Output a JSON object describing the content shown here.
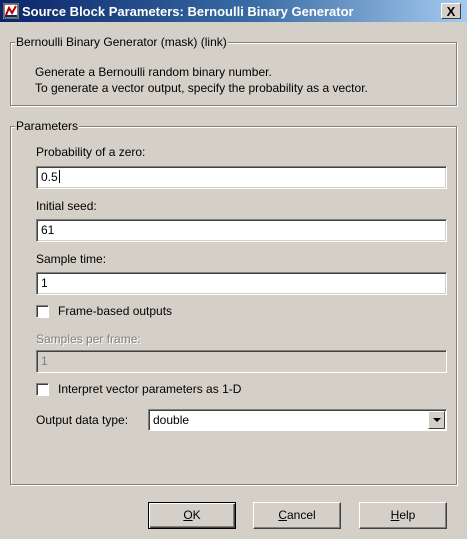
{
  "window": {
    "title": "Source Block Parameters: Bernoulli Binary Generator",
    "close_label": "X"
  },
  "description_group": {
    "legend": "Bernoulli Binary Generator (mask) (link)",
    "line1": "Generate a Bernoulli random binary number.",
    "line2": "To generate a vector output, specify the probability as a vector."
  },
  "parameters_group": {
    "legend": "Parameters",
    "probability_label": "Probability of a zero:",
    "probability_value": "0.5",
    "seed_label": "Initial seed:",
    "seed_value": "61",
    "sample_time_label": "Sample time:",
    "sample_time_value": "1",
    "frame_based_label": "Frame-based outputs",
    "frame_based_checked": false,
    "samples_per_frame_label": "Samples per frame:",
    "samples_per_frame_value": "1",
    "interpret_vector_label": "Interpret vector parameters as 1-D",
    "interpret_vector_checked": false,
    "output_type_label": "Output data type:",
    "output_type_value": "double"
  },
  "buttons": {
    "ok_mnemonic": "O",
    "ok_rest": "K",
    "cancel_mnemonic": "C",
    "cancel_rest": "ancel",
    "help_mnemonic": "H",
    "help_rest": "elp"
  },
  "colors": {
    "titlebar_start": "#0a246a",
    "titlebar_end": "#a6caf0",
    "dialog_face": "#d4d0c8"
  }
}
